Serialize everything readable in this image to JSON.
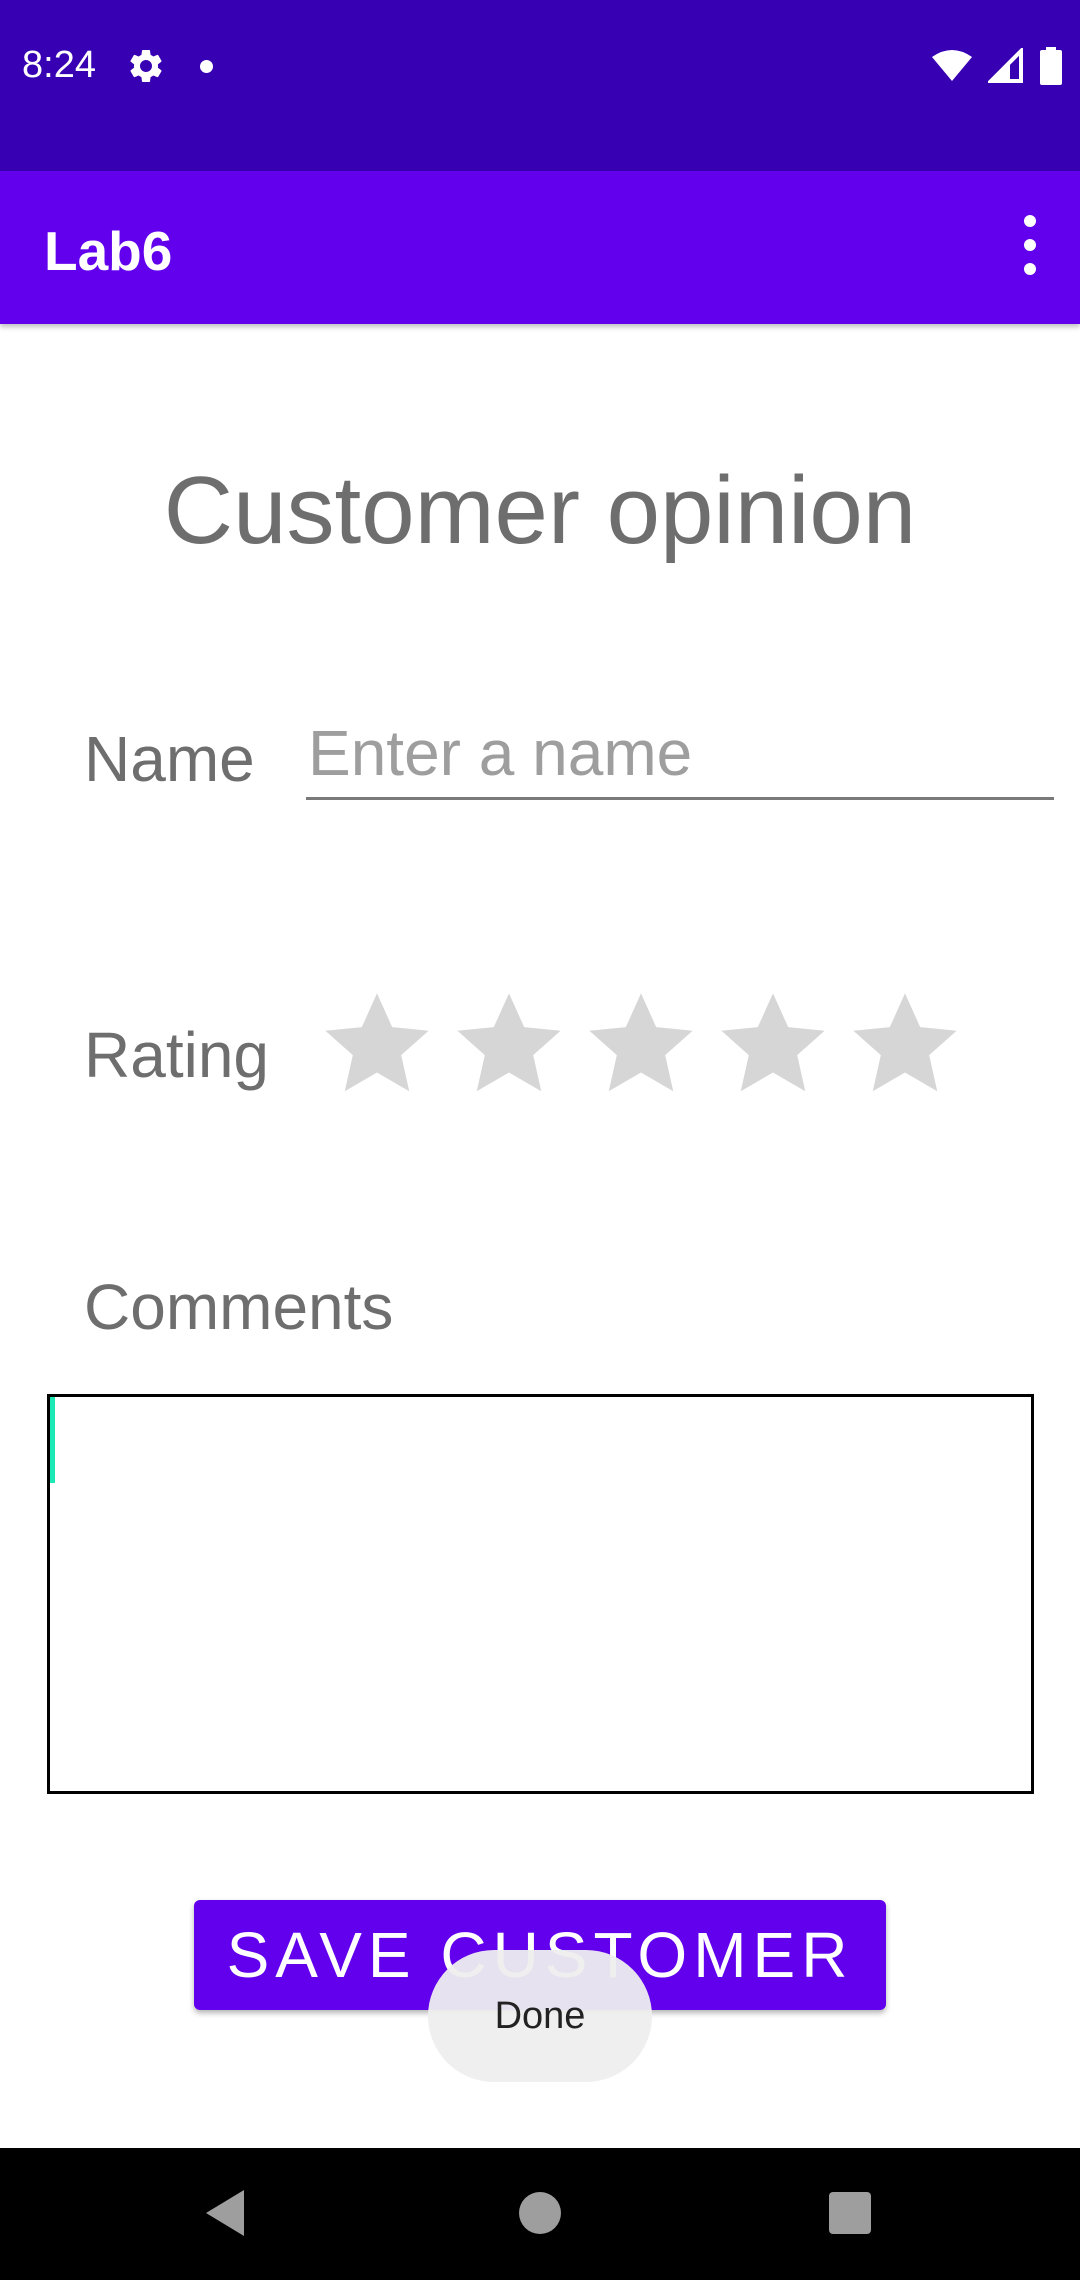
{
  "status_bar": {
    "time": "8:24",
    "icons": [
      "gear-icon",
      "notification-dot-icon",
      "wifi-icon",
      "cellular-signal-icon",
      "battery-icon"
    ],
    "background": "#3700B3"
  },
  "app_bar": {
    "title": "Lab6",
    "menu_icon": "more-vert-icon",
    "background": "#6200EE"
  },
  "form": {
    "title": "Customer opinion",
    "name_label": "Name",
    "name_value": "",
    "name_placeholder": "Enter a name",
    "rating_label": "Rating",
    "rating": {
      "value": 0,
      "max": 5
    },
    "comments_label": "Comments",
    "comments_value": ""
  },
  "save_button": {
    "label": "SAVE CUSTOMER",
    "color": "#6200EE"
  },
  "toast": {
    "text": "Done"
  },
  "nav_bar": {
    "icons": [
      "back-icon",
      "home-icon",
      "recents-icon"
    ]
  }
}
